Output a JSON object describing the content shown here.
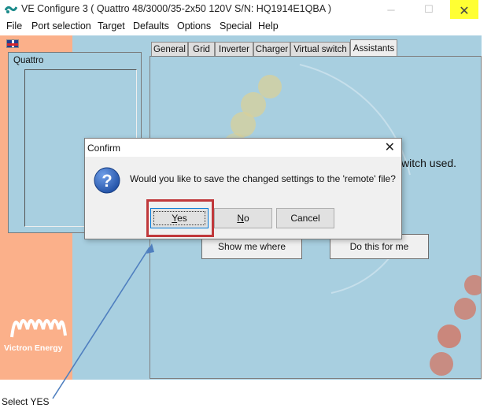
{
  "window": {
    "title": "VE Configure 3    ( Quattro 48/3000/35-2x50 120V S/N: HQ1914E1QBA )",
    "minimize_icon": "minimize-icon",
    "maximize_icon": "maximize-icon",
    "close_icon": "close-icon",
    "close_highlight_color": "#ffff33"
  },
  "menu": {
    "items": [
      "File",
      "Port selection",
      "Target",
      "Defaults",
      "Options",
      "Special",
      "Help"
    ]
  },
  "left_panel": {
    "flag_icon": "uk-flag-icon",
    "device_label": "Quattro",
    "logo_text": "Victron Energy",
    "background_color": "#fbb08a"
  },
  "tabs": [
    "General",
    "Grid",
    "Inverter",
    "Charger",
    "Virtual switch",
    "Assistants"
  ],
  "active_tab": "Assistants",
  "panel": {
    "partial_text": "witch used.",
    "show_me_where_label": "Show me where",
    "do_this_for_me_label": "Do this for me",
    "background_color": "#a8cfe0"
  },
  "dialog": {
    "title": "Confirm",
    "close_glyph": "✕",
    "question_icon": "question-icon",
    "message": "Would you like to save the changed settings to the 'remote' file?",
    "yes_label": "Yes",
    "no_label": "No",
    "cancel_label": "Cancel"
  },
  "annotation": {
    "caption": "Select YES",
    "highlight_color": "#c0383b",
    "arrow_color": "#4f7fbf"
  }
}
